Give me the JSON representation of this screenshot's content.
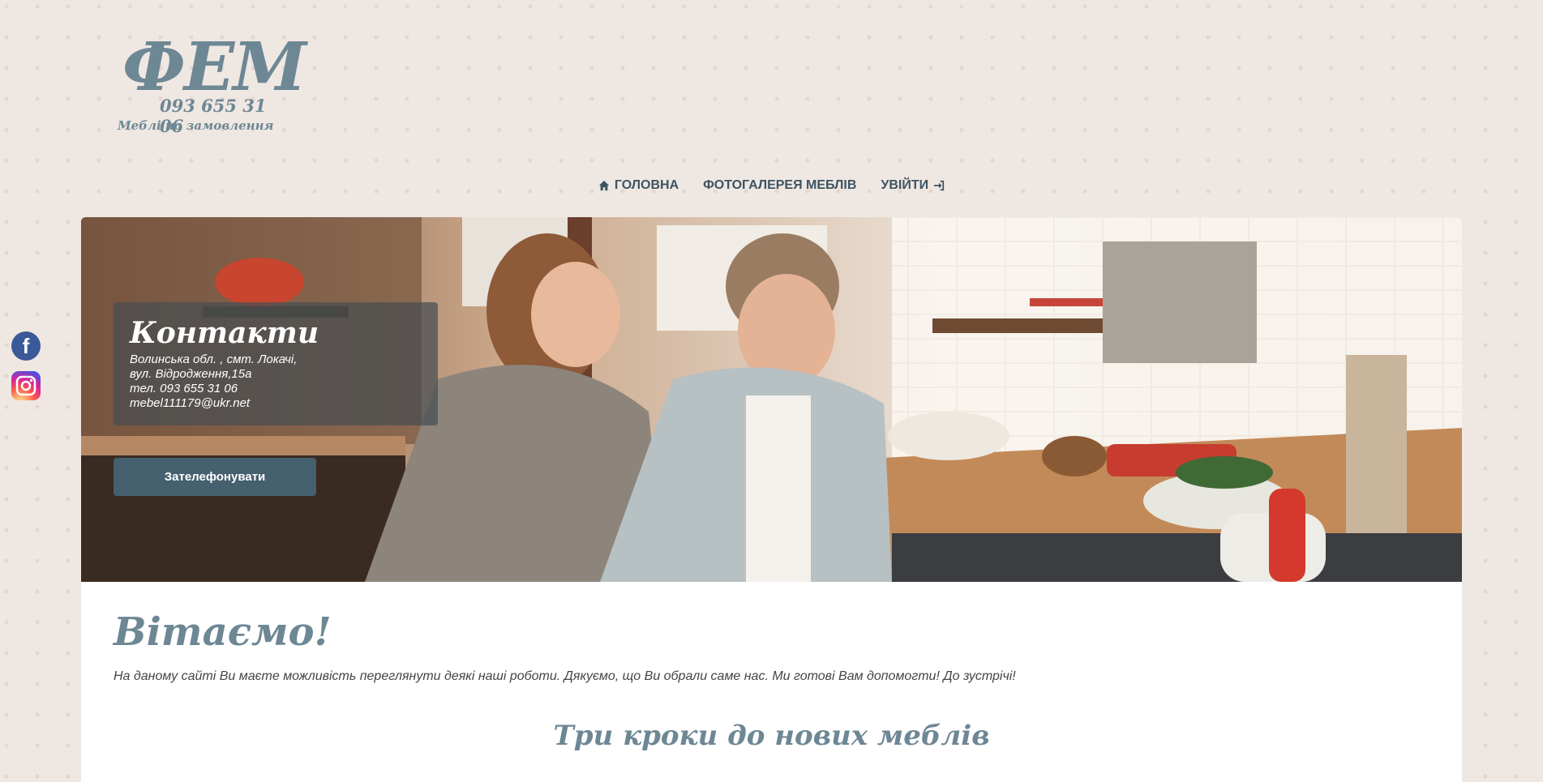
{
  "logo": {
    "text": "ФЕМ",
    "phone": "093 655 31 06",
    "tagline": "Меблі на замовлення"
  },
  "nav": {
    "items": [
      {
        "label": "ГОЛОВНА",
        "icon": "home-icon"
      },
      {
        "label": "ФОТОГАЛЕРЕЯ МЕБЛІВ",
        "icon": ""
      },
      {
        "label": "УВІЙТИ",
        "icon": "sign-in-icon"
      }
    ]
  },
  "social": {
    "facebook_icon": "facebook-icon",
    "facebook_glyph": "f",
    "instagram_icon": "instagram-icon"
  },
  "hero": {
    "contacts_title": "Контакти",
    "lines": [
      "Волинська обл. , смт. Локачі,",
      "вул. Відродження,15а",
      "тел. 093 655 31 06",
      "mebel111179@ukr.net"
    ],
    "call_button": "Зателефонувати"
  },
  "content": {
    "welcome": "Вітаємо!",
    "intro": "На даному сайті Ви маєте можливість переглянути деякі наші роботи. Дякуємо, що Ви обрали саме нас. Ми готові Вам допомогти! До зустрічі!",
    "steps_title": "Три кроки до нових меблів"
  },
  "colors": {
    "background": "#efe7e2",
    "accent": "#6d8794",
    "nav_text": "#3d5463",
    "button": "#45606f"
  }
}
